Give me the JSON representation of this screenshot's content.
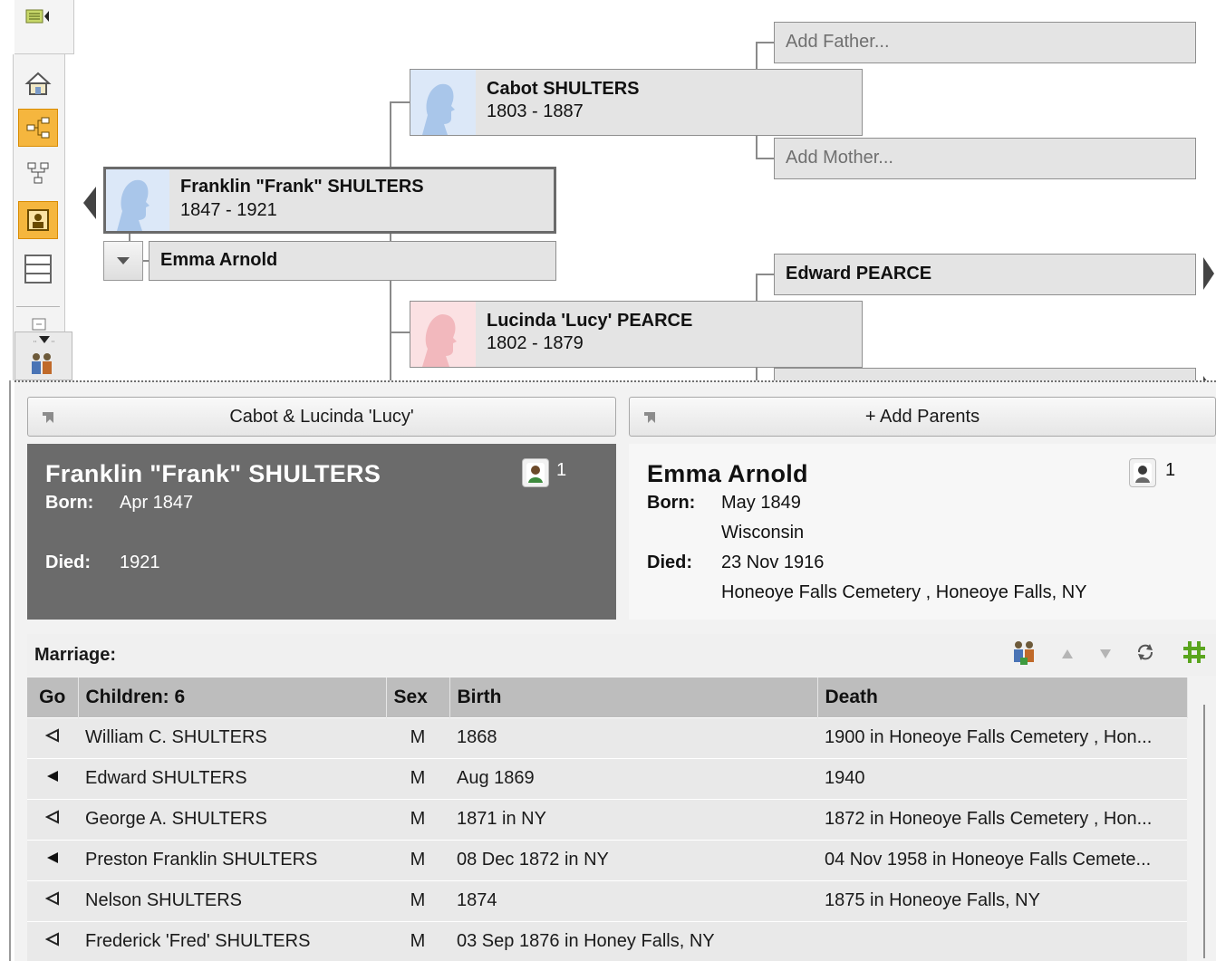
{
  "toolbar": {
    "items": [
      {
        "icon": "menu-collapse-icon"
      },
      {
        "icon": "home-icon"
      },
      {
        "icon": "pedigree-view-icon",
        "active": true
      },
      {
        "icon": "descendant-view-icon"
      },
      {
        "icon": "person-view-icon",
        "active": true
      },
      {
        "icon": "family-view-icon"
      },
      {
        "icon": "more-views-icon"
      },
      {
        "icon": "family-group-icon"
      }
    ]
  },
  "tree": {
    "focus": {
      "name": "Franklin \"Frank\" SHULTERS",
      "dates": "1847 - 1921"
    },
    "spouse": {
      "name": "Emma Arnold"
    },
    "father": {
      "name": "Cabot SHULTERS",
      "dates": "1803 - 1887"
    },
    "mother": {
      "name": "Lucinda 'Lucy' PEARCE",
      "dates": "1802 - 1879"
    },
    "paternal_grandfather": {
      "placeholder": "Add Father..."
    },
    "paternal_grandmother": {
      "placeholder": "Add Mother..."
    },
    "maternal_grandfather": {
      "name": "Edward PEARCE"
    }
  },
  "parents_buttons": {
    "left": "Cabot & Lucinda 'Lucy'",
    "right": "+ Add Parents"
  },
  "person_card": {
    "name": "Franklin \"Frank\" SHULTERS",
    "born_label": "Born:",
    "born": "Apr 1847",
    "died_label": "Died:",
    "died": "1921",
    "media_count": "1"
  },
  "spouse_card": {
    "name": "Emma Arnold",
    "born_label": "Born:",
    "born": "May 1849",
    "born_place": "Wisconsin",
    "died_label": "Died:",
    "died": "23 Nov 1916",
    "died_place": "Honeoye Falls Cemetery , Honeoye Falls, NY",
    "media_count": "1"
  },
  "marriage": {
    "label": "Marriage:"
  },
  "children_table": {
    "headers": {
      "go": "Go",
      "children": "Children: 6",
      "sex": "Sex",
      "birth": "Birth",
      "death": "Death"
    },
    "rows": [
      {
        "filled": false,
        "name": "William C. SHULTERS",
        "sex": "M",
        "birth": "1868",
        "death": "1900 in Honeoye Falls Cemetery , Hon..."
      },
      {
        "filled": true,
        "name": "Edward SHULTERS",
        "sex": "M",
        "birth": "Aug 1869",
        "death": "1940"
      },
      {
        "filled": false,
        "name": "George A. SHULTERS",
        "sex": "M",
        "birth": "1871 in NY",
        "death": "1872 in Honeoye Falls Cemetery , Hon..."
      },
      {
        "filled": true,
        "name": "Preston Franklin SHULTERS",
        "sex": "M",
        "birth": "08 Dec 1872 in NY",
        "death": "04 Nov 1958 in Honeoye Falls Cemete..."
      },
      {
        "filled": false,
        "name": "Nelson SHULTERS",
        "sex": "M",
        "birth": "1874",
        "death": "1875 in Honeoye Falls, NY"
      },
      {
        "filled": false,
        "name": "Frederick 'Fred' SHULTERS",
        "sex": "M",
        "birth": "03 Sep 1876 in Honey Falls, NY",
        "death": ""
      }
    ]
  },
  "colors": {
    "accent": "#f5b63e",
    "male_photo": "#dce8f8",
    "female_photo": "#fbe1e3",
    "card_dark": "#6b6b6b"
  }
}
